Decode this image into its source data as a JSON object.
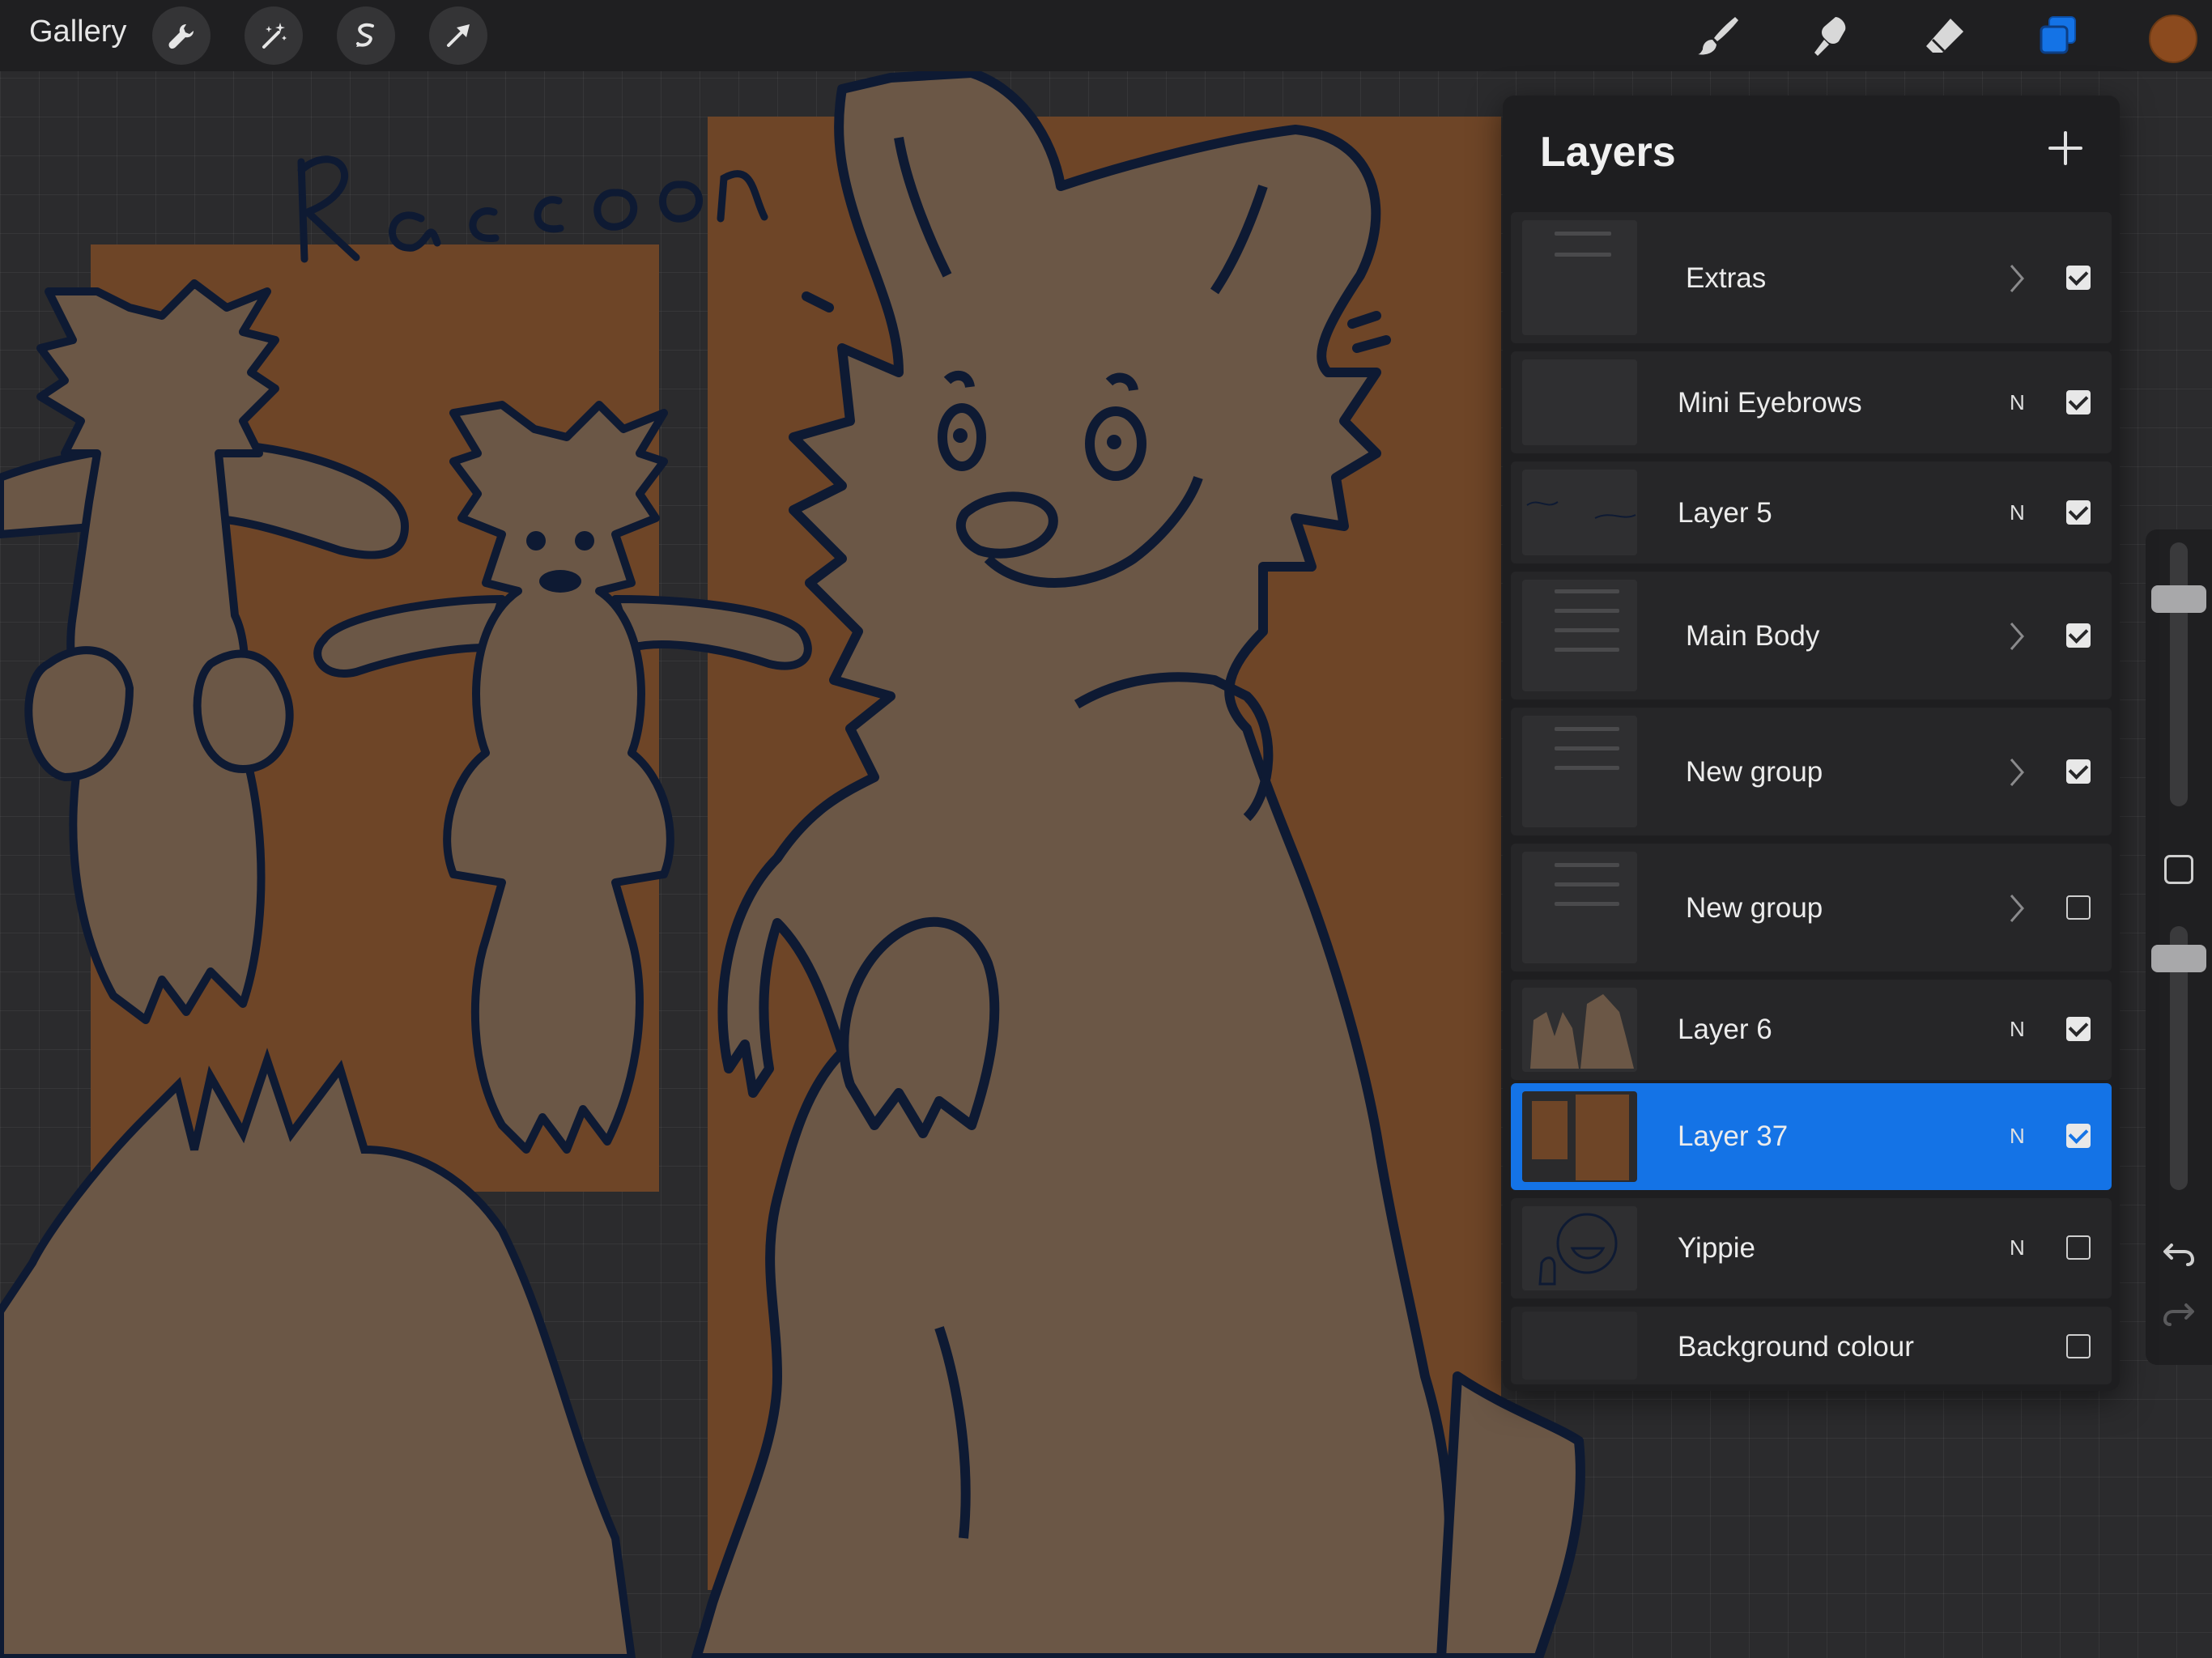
{
  "topbar": {
    "gallery_label": "Gallery",
    "left_tools": [
      "wrench-icon",
      "magic-wand-icon",
      "selection-icon",
      "transform-arrow-icon"
    ],
    "right_tools": [
      "brush-icon",
      "smudge-icon",
      "eraser-icon",
      "layers-icon"
    ],
    "current_color": "#8b4a1e",
    "active_tool_color": "#1473e6"
  },
  "canvas": {
    "handwritten_title": "Raccoon",
    "fill_colors": {
      "fur": "#6b5746",
      "outline": "#0e1a33",
      "backdrop": "#6e4527"
    }
  },
  "layers_panel": {
    "title": "Layers",
    "layers": [
      {
        "name": "Extras",
        "type": "group",
        "mode": "",
        "visible": true,
        "selected": false
      },
      {
        "name": "Mini Eyebrows",
        "type": "layer",
        "mode": "N",
        "visible": true,
        "selected": false
      },
      {
        "name": "Layer 5",
        "type": "layer",
        "mode": "N",
        "visible": true,
        "selected": false
      },
      {
        "name": "Main Body",
        "type": "group",
        "mode": "",
        "visible": true,
        "selected": false
      },
      {
        "name": "New group",
        "type": "group",
        "mode": "",
        "visible": true,
        "selected": false
      },
      {
        "name": "New group",
        "type": "group",
        "mode": "",
        "visible": false,
        "selected": false
      },
      {
        "name": "Layer 6",
        "type": "layer",
        "mode": "N",
        "visible": true,
        "selected": false
      },
      {
        "name": "Layer 37",
        "type": "layer",
        "mode": "N",
        "visible": true,
        "selected": true
      },
      {
        "name": "Yippie",
        "type": "layer",
        "mode": "N",
        "visible": false,
        "selected": false
      },
      {
        "name": "Background colour",
        "type": "background",
        "mode": "",
        "visible": false,
        "selected": false
      }
    ]
  },
  "sidebar": {
    "brush_size_level": 0.82,
    "opacity_level": 0.92,
    "icons": [
      "modify-square-icon",
      "undo-icon",
      "redo-icon"
    ]
  }
}
